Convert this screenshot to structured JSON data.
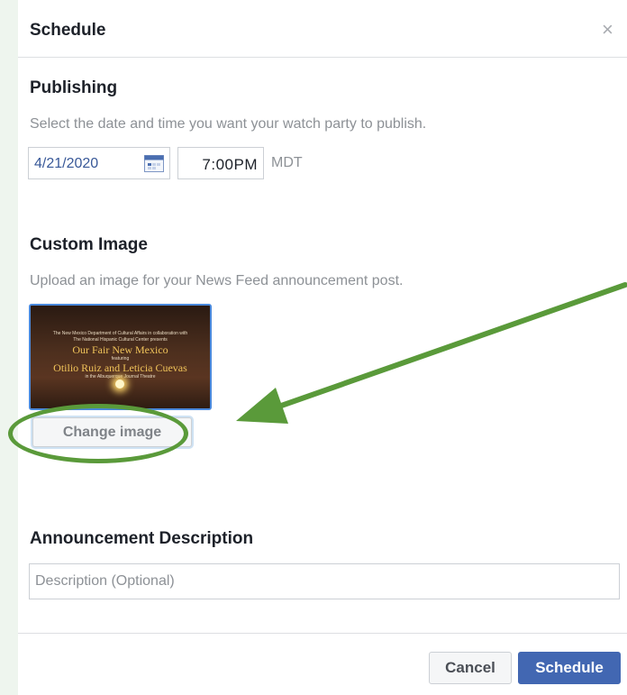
{
  "dialog": {
    "title": "Schedule",
    "close_icon": "×"
  },
  "publishing": {
    "heading": "Publishing",
    "helper": "Select the date and time you want your watch party to publish.",
    "date": "4/21/2020",
    "time": "7:00PM",
    "timezone": "MDT"
  },
  "custom_image": {
    "heading": "Custom Image",
    "helper": "Upload an image for your News Feed announcement post.",
    "thumbnail_text": {
      "line1": "The New Mexico Department of Cultural Affairs in collaboration with",
      "line2": "The National Hispanic Cultural Center presents",
      "title": "Our Fair New Mexico",
      "featuring": "featuring",
      "names": "Otilio Ruiz and Leticia Cuevas",
      "venue": "in the Albuquerque Journal Theatre"
    },
    "change_button": "Change image"
  },
  "announcement": {
    "heading": "Announcement Description",
    "placeholder": "Description (Optional)"
  },
  "footer": {
    "cancel": "Cancel",
    "schedule": "Schedule"
  },
  "annotation": {
    "color": "#5a9a3a"
  }
}
